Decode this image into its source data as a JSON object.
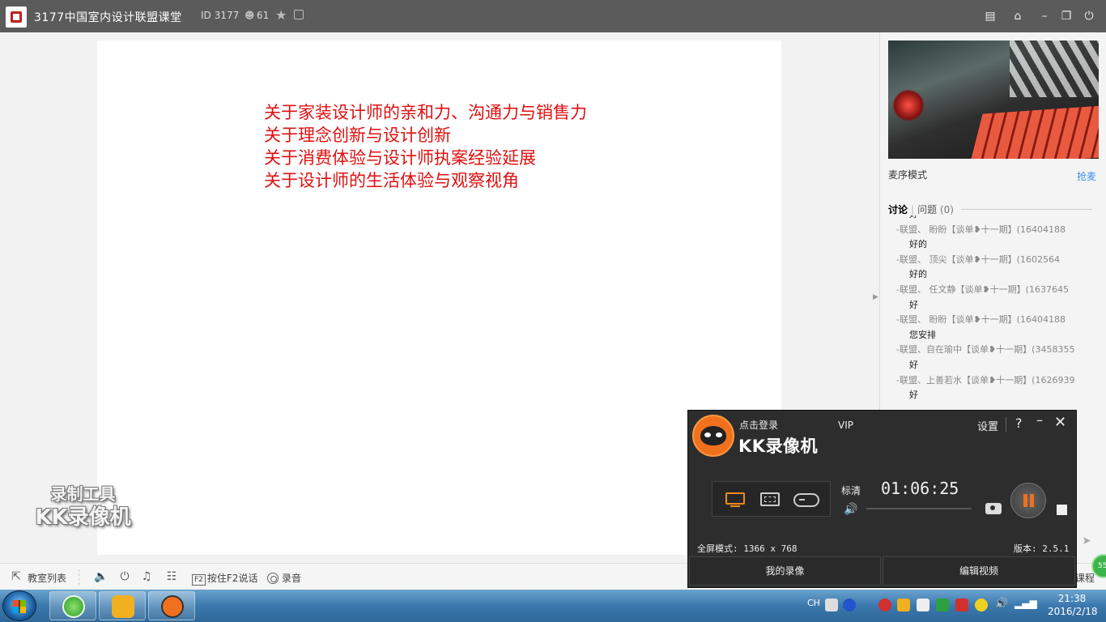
{
  "app": {
    "title": "3177中国室内设计联盟课堂",
    "id_label": "ID",
    "id_value": "3177",
    "user_count": "61"
  },
  "slide": {
    "lines": [
      "关于家装设计师的亲和力、沟通力与销售力",
      "关于理念创新与设计创新",
      "关于消费体验与设计师执案经验延展",
      "关于设计师的生活体验与观察视角"
    ]
  },
  "watermark": {
    "line1": "录制工具",
    "line2": "KK录像机"
  },
  "panel": {
    "mode": "麦序模式",
    "grab": "抢麦",
    "tab_discuss": "讨论",
    "tab_questions": "问题",
    "tab_questions_count": "(0)",
    "chat": [
      {
        "meta": "",
        "msg": "好"
      },
      {
        "meta": "-联盟、      盼盼【谈单❥十一期】(16404188",
        "msg": "好的"
      },
      {
        "meta": "-联盟、      顶尖【谈单❥十一期】(1602564",
        "msg": "好的"
      },
      {
        "meta": "-联盟、    任文静【谈单❥十一期】(1637645",
        "msg": "好"
      },
      {
        "meta": "-联盟、      盼盼【谈单❥十一期】(16404188",
        "msg": "您安排"
      },
      {
        "meta": "-联盟、自在瑜中【谈单❥十一期】(3458355",
        "msg": "好"
      },
      {
        "meta": "-联盟、上善若水【谈单❥十一期】(1626939",
        "msg": "好"
      }
    ]
  },
  "toolbar": {
    "classroom_list": "教室列表",
    "f2_key": "F2",
    "push_to_talk": "按住F2说话",
    "record": "录音",
    "course": "课程",
    "badge": "55"
  },
  "kk": {
    "login": "点击登录",
    "vip": "VIP",
    "name": "KK录像机",
    "settings": "设置",
    "help": "?",
    "quality": "标清",
    "time": "01:06:25",
    "fullscreen_mode": "全屏模式: 1366 x 768",
    "version": "版本: 2.5.1",
    "my_recordings": "我的录像",
    "edit_video": "编辑视频",
    "accent_color": "#f07020"
  },
  "taskbar": {
    "lang": "CH",
    "time": "21:38",
    "date": "2016/2/18"
  }
}
